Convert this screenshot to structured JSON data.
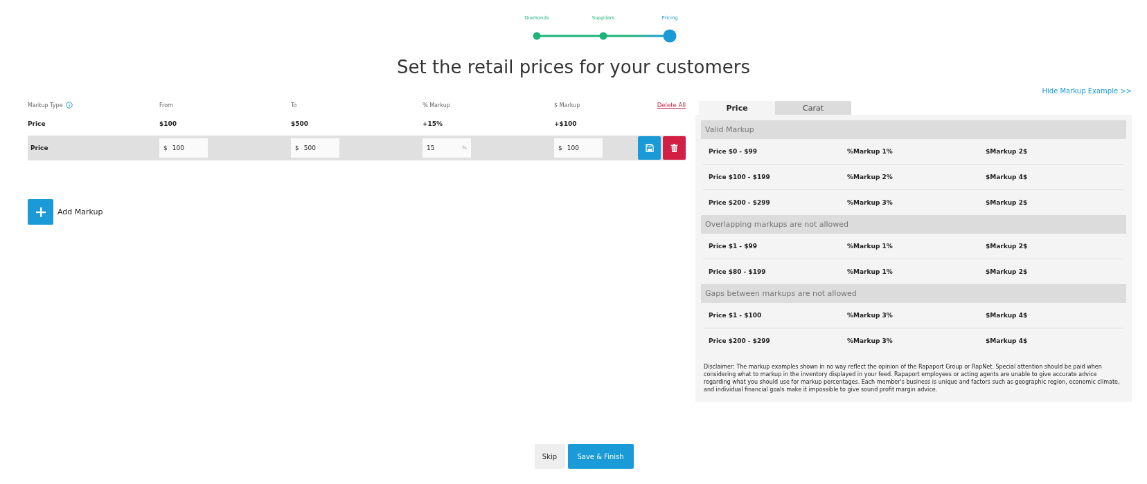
{
  "stepper": [
    {
      "label": "Diamonds",
      "completed": true,
      "selected": false
    },
    {
      "label": "Suppliers",
      "completed": true,
      "selected": false
    },
    {
      "label": "Pricing",
      "completed": false,
      "selected": true
    }
  ],
  "title": "Set the retail prices for your customers",
  "markups": {
    "columns": [
      "Markup Type",
      "From",
      "To",
      "% Markup",
      "$ Markup"
    ],
    "delete_all": "Delete All",
    "rows": [
      {
        "kind": "saved",
        "type": "Price",
        "from": "$100",
        "to": "$500",
        "percent": "+15%",
        "dollar": "+$100"
      },
      {
        "kind": "editing",
        "type": "Price",
        "from_prefix": "$",
        "from": "100",
        "to_prefix": "$",
        "to": "500",
        "percent": "15",
        "percent_suffix": "%",
        "dollar_prefix": "$",
        "dollar": "100"
      }
    ],
    "add_label": "Add Markup"
  },
  "example": {
    "toggle_link": "Hide Markup Example >>",
    "tabs": [
      {
        "label": "Price",
        "selected": true
      },
      {
        "label": "Carat",
        "selected": false
      }
    ],
    "sections": [
      {
        "title": "Valid Markup",
        "rows": [
          [
            "Price $0 - $99",
            "%Markup 1%",
            "$Markup 2$"
          ],
          [
            "Price $100 - $199",
            "%Markup 2%",
            "$Markup 4$"
          ],
          [
            "Price $200 - $299",
            "%Markup 3%",
            "$Markup 2$"
          ]
        ]
      },
      {
        "title": "Overlapping markups are not allowed",
        "rows": [
          [
            "Price $1 - $99",
            "%Markup 1%",
            "$Markup 2$"
          ],
          [
            "Price $80 - $199",
            "%Markup 1%",
            "$Markup 2$"
          ]
        ]
      },
      {
        "title": "Gaps between markups are not allowed",
        "rows": [
          [
            "Price $1 - $100",
            "%Markup 3%",
            "$Markup 4$"
          ],
          [
            "Price $200 - $299",
            "%Markup 3%",
            "$Markup 4$"
          ]
        ]
      }
    ],
    "disclaimer": "Disclaimer: The markup examples shown in no way reflect the opinion of the Rapaport Group or RapNet. Special attention should be paid when considering what to markup in the inventory displayed in your feed. Rapaport employees or acting agents are unable to give accurate advice regarding what you should use for markup percentages. Each member's business is unique and factors such as geographic region, economic climate, and individual financial goals make it impossible to give sound profit margin advice."
  },
  "footer": {
    "skip": "Skip",
    "save": "Save & Finish"
  }
}
